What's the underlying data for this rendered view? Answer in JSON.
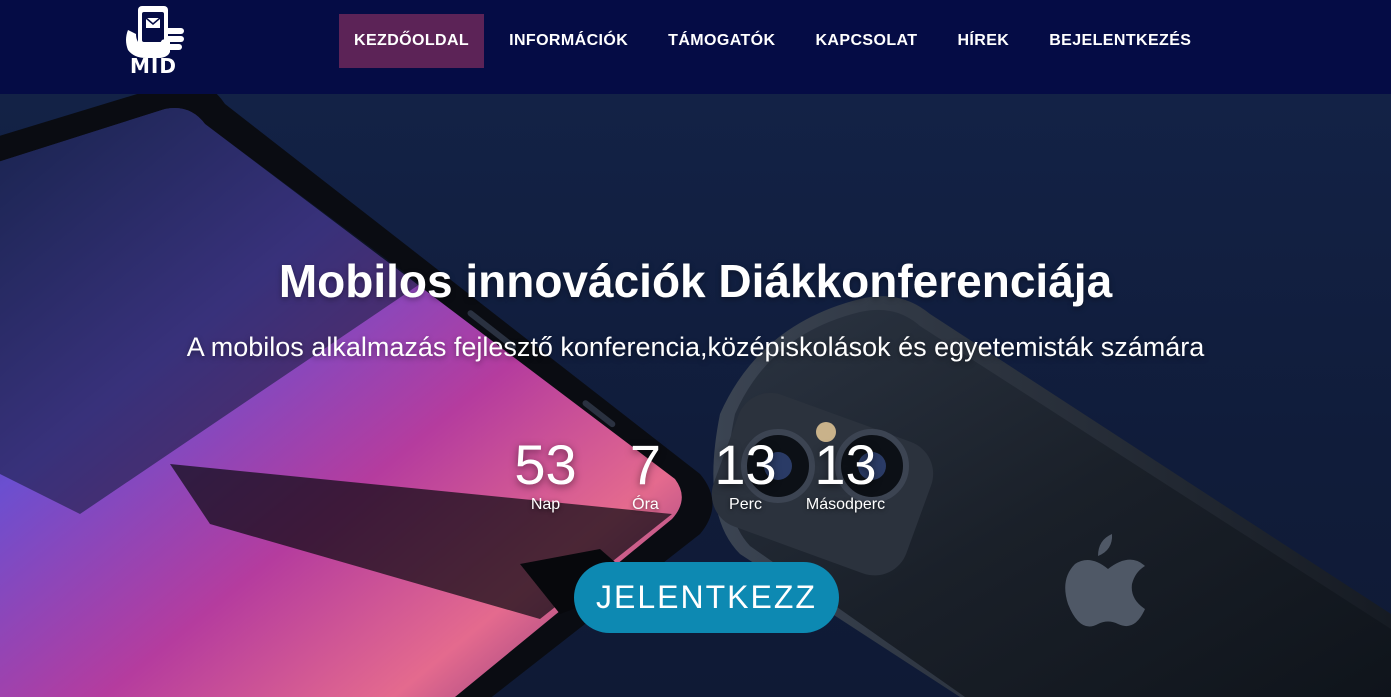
{
  "brand": {
    "logo_text": "MID",
    "colors": {
      "nav_bg": "#050c45",
      "active_bg": "#5c2357",
      "cta_bg": "#0d89b2"
    }
  },
  "nav": {
    "items": [
      {
        "label": "KEZDŐOLDAL",
        "active": true
      },
      {
        "label": "INFORMÁCIÓK"
      },
      {
        "label": "TÁMOGATÓK"
      },
      {
        "label": "KAPCSOLAT"
      },
      {
        "label": "HÍREK"
      },
      {
        "label": "BEJELENTKEZÉS"
      }
    ]
  },
  "hero": {
    "title": "Mobilos innovációk Diákkonferenciája",
    "subtitle": "A mobilos alkalmazás fejlesztő konferencia,középiskolások és egyetemisták számára",
    "countdown": [
      {
        "value": "53",
        "label": "Nap"
      },
      {
        "value": "7",
        "label": "Óra"
      },
      {
        "value": "13",
        "label": "Perc"
      },
      {
        "value": "13",
        "label": "Másodperc"
      }
    ],
    "cta_label": "JELENTKEZZ"
  },
  "icons": {
    "logo": "hand-holding-phone-icon",
    "phone_logo": "apple-logo-icon"
  }
}
